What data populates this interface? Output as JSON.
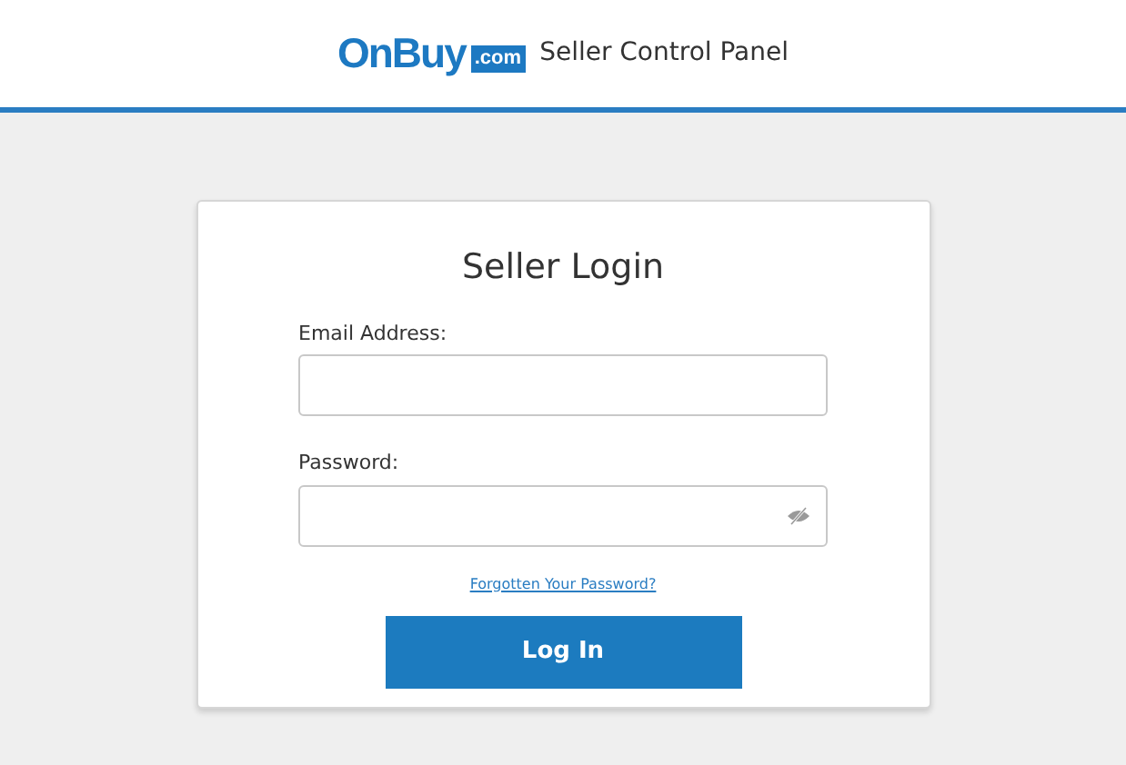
{
  "header": {
    "logo": {
      "name": "OnBuy",
      "suffix": ".com"
    },
    "title": "Seller Control Panel"
  },
  "login": {
    "title": "Seller Login",
    "fields": [
      {
        "label": "Email Address:",
        "kind": "text"
      },
      {
        "label": "Password:",
        "kind": "password"
      }
    ],
    "forgot_link": "Forgotten Your Password?",
    "submit": "Log In"
  }
}
